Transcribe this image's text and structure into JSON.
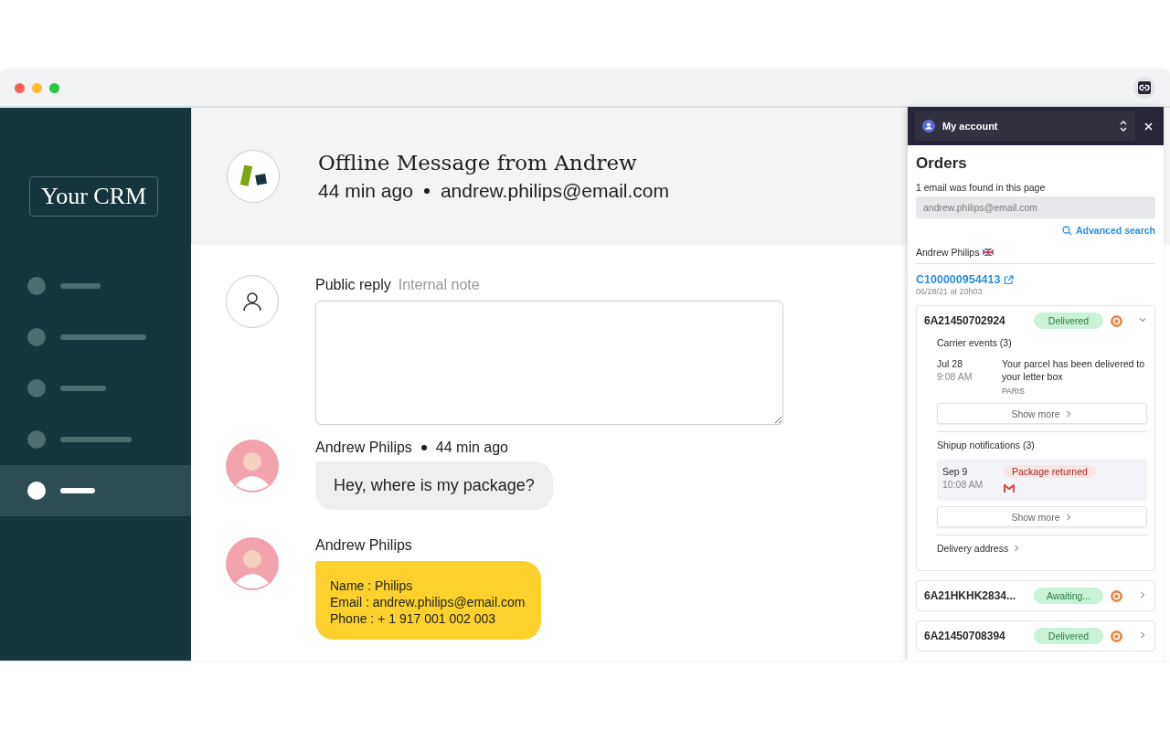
{
  "sidebar": {
    "logo": "Your CRM",
    "items": [
      {
        "selected": false
      },
      {
        "selected": false
      },
      {
        "selected": false
      },
      {
        "selected": false
      },
      {
        "selected": true
      }
    ]
  },
  "ticket": {
    "title": "Offline Message from Andrew",
    "time": "44 min ago",
    "email": "andrew.philips@email.com"
  },
  "reply": {
    "tabs": [
      {
        "label": "Public reply",
        "selected": true
      },
      {
        "label": "Internal note",
        "selected": false
      }
    ]
  },
  "messages": [
    {
      "kind": "bubble",
      "author": "Andrew Philips",
      "time": "44 min ago",
      "lines": [
        "Hey, where is my package?"
      ]
    },
    {
      "kind": "card",
      "author": "Andrew Philips",
      "lines": [
        "Name : Philips",
        "Email : andrew.philips@email.com",
        "Phone : + 1 917 001 002 003"
      ]
    }
  ],
  "panel": {
    "account": "My account",
    "title": "Orders",
    "found": "1 email was found in this page",
    "search_value": "andrew.philips@email.com",
    "advanced_search": "Advanced search",
    "customer": "Andrew Philips",
    "order_number": "C100000954413",
    "order_date": "06/28/21 at 20h03",
    "shipments": [
      {
        "tracking": "6A21450702924",
        "status": "Delivered",
        "expanded": true,
        "carrier_events": {
          "title": "Carrier events (3)",
          "date": "Jul 28",
          "time": "9:08 AM",
          "text": "Your parcel has been delivered to your letter box",
          "place": "PARIS",
          "more": "Show more"
        },
        "notifications": {
          "title": "Shipup notifications (3)",
          "date": "Sep 9",
          "time": "10:08 AM",
          "tag": "Package returned",
          "more": "Show more"
        },
        "address": "Delivery address"
      },
      {
        "tracking": "6A21HKHK2834...",
        "status": "Awaiting...",
        "expanded": false
      },
      {
        "tracking": "6A21450708394",
        "status": "Delivered",
        "expanded": false
      }
    ]
  }
}
